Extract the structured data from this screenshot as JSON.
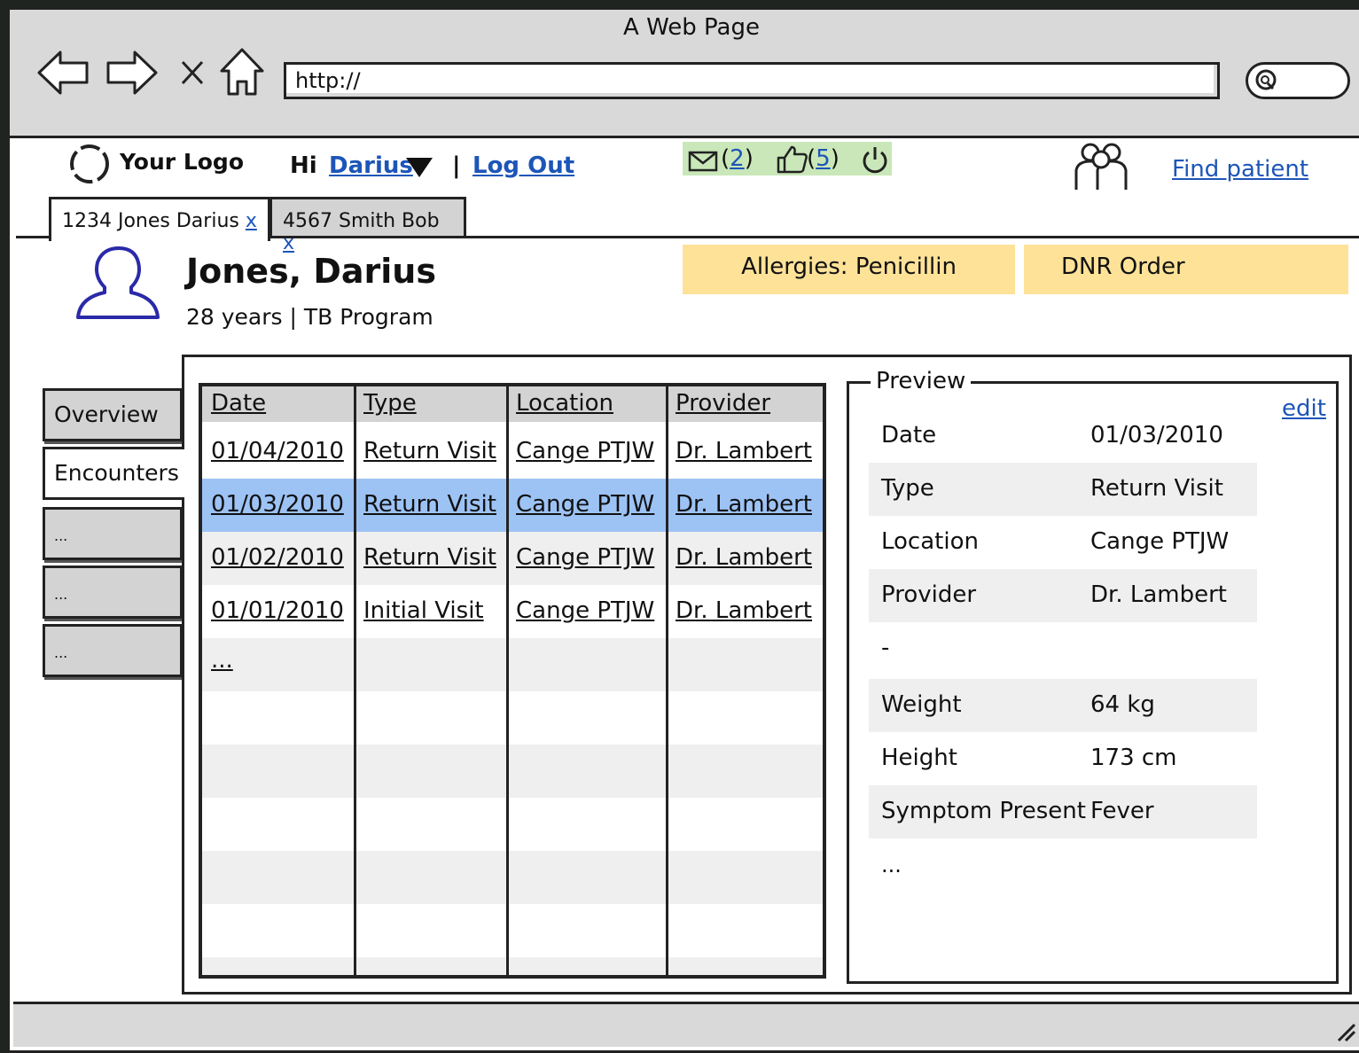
{
  "browser": {
    "title": "A Web Page",
    "url": "http://"
  },
  "header": {
    "logo": "Your Logo",
    "greeting": "Hi",
    "user": "Darius",
    "separator": "|",
    "logout": "Log Out",
    "messages_count": "2",
    "likes_count": "5",
    "find_patient": "Find patient",
    "badge_color": "#c9e7b8"
  },
  "tabs": [
    {
      "label": "1234 Jones Darius",
      "close": "x"
    },
    {
      "label": "4567 Smith Bob",
      "close": "x"
    }
  ],
  "patient": {
    "name": "Jones, Darius",
    "age": "28 years",
    "separator": "|",
    "program": "TB Program",
    "allergies": "Allergies: Penicillin",
    "dnr": "DNR Order",
    "alert_color": "#fde298"
  },
  "sidebar": [
    "Overview",
    "Encounters",
    "...",
    "...",
    "..."
  ],
  "encounters": {
    "headers": [
      "Date",
      "Type",
      "Location",
      "Provider"
    ],
    "rows": [
      {
        "date": "01/04/2010",
        "type": "Return Visit",
        "location": "Cange PTJW",
        "provider": "Dr. Lambert"
      },
      {
        "date": "01/03/2010",
        "type": "Return Visit",
        "location": "Cange PTJW",
        "provider": "Dr. Lambert"
      },
      {
        "date": "01/02/2010",
        "type": "Return Visit",
        "location": "Cange PTJW",
        "provider": "Dr. Lambert"
      },
      {
        "date": "01/01/2010",
        "type": "Initial Visit",
        "location": "Cange PTJW",
        "provider": "Dr. Lambert"
      }
    ],
    "more": "...",
    "selected_color": "#9dc3f5"
  },
  "preview": {
    "title": "Preview",
    "edit": "edit",
    "fields": [
      {
        "label": "Date",
        "value": "01/03/2010"
      },
      {
        "label": "Type",
        "value": "Return Visit"
      },
      {
        "label": "Location",
        "value": "Cange PTJW"
      },
      {
        "label": "Provider",
        "value": "Dr. Lambert"
      },
      {
        "label": "-",
        "value": ""
      },
      {
        "label": "Weight",
        "value": "64 kg"
      },
      {
        "label": "Height",
        "value": "173 cm"
      },
      {
        "label": "Symptom Present",
        "value": "Fever"
      }
    ],
    "more": "..."
  }
}
